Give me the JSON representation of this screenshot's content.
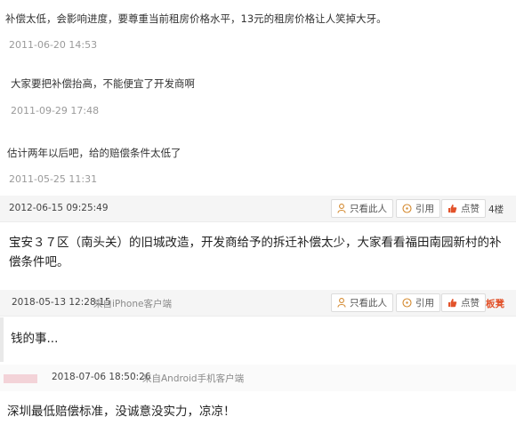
{
  "sub_replies": [
    {
      "text": "补偿太低，会影响进度，要尊重当前租房价格水平，13元的租房价格让人笑掉大牙。",
      "time": "2011-06-20 14:53"
    },
    {
      "text": "大家要把补偿抬高，不能便宜了开发商啊",
      "time": "2011-09-29 17:48"
    },
    {
      "text": "估计两年以后吧，给的赔偿条件太低了",
      "time": "2011-05-25 11:31"
    }
  ],
  "floors": [
    {
      "time": "2012-06-15 09:25:49",
      "source": "",
      "only_label": "只看此人",
      "quote_label": "引用",
      "like_label": "点赞",
      "floor_label": "4楼",
      "body": "宝安３７区（南头关）的旧城改造，开发商给予的拆迁补偿太少，大家看看福田南园新村的补偿条件吧。"
    },
    {
      "time": "2018-05-13 12:28:15",
      "source": "来自iPhone客户端",
      "only_label": "只看此人",
      "quote_label": "引用",
      "like_label": "点赞",
      "floor_label": "板凳",
      "body": "钱的事..."
    },
    {
      "time": "2018-07-06 18:50:26",
      "source": "来自Android手机客户端",
      "body": "深圳最低赔偿标准，没诚意没实力，凉凉！"
    }
  ],
  "colors": {
    "floor_bar_bg": "#f5f5f5",
    "accent_red": "#e2522a",
    "time_gray": "#9a9a9a"
  },
  "icons": {
    "only": "person-icon",
    "quote": "quote-bubble-icon",
    "like": "thumbs-up-icon"
  }
}
